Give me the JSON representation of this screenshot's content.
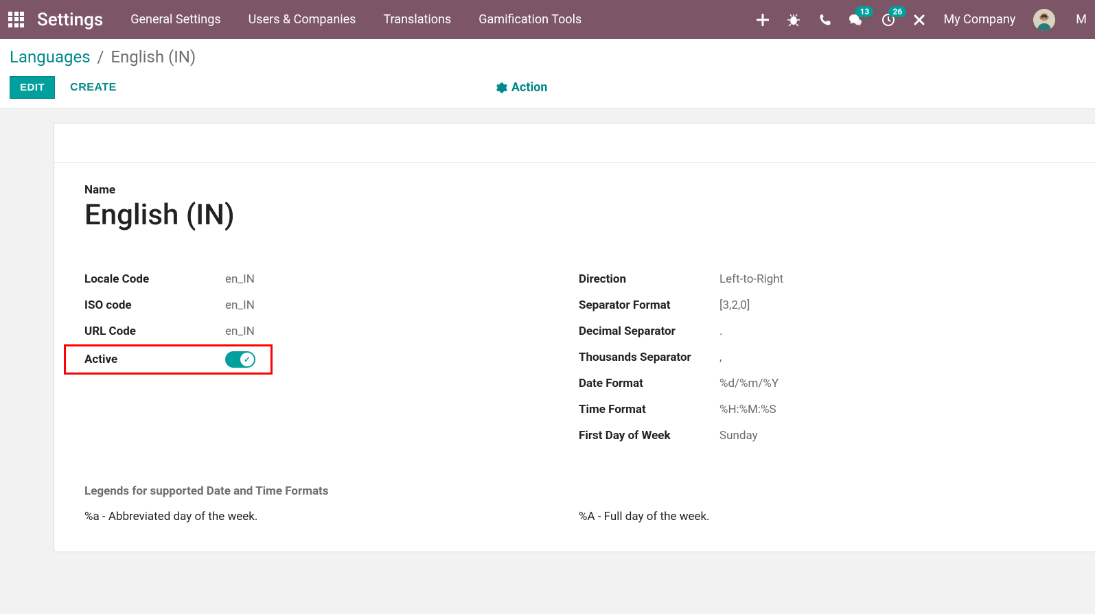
{
  "navbar": {
    "brand": "Settings",
    "links": [
      "General Settings",
      "Users & Companies",
      "Translations",
      "Gamification Tools"
    ],
    "chat_badge": "13",
    "activity_badge": "26",
    "company": "My Company",
    "user_initial": "M"
  },
  "breadcrumb": {
    "parent": "Languages",
    "current": "English (IN)"
  },
  "buttons": {
    "edit": "EDIT",
    "create": "CREATE",
    "action": "Action"
  },
  "form": {
    "name_label": "Name",
    "name_value": "English (IN)",
    "left": [
      {
        "label": "Locale Code",
        "value": "en_IN"
      },
      {
        "label": "ISO code",
        "value": "en_IN"
      },
      {
        "label": "URL Code",
        "value": "en_IN"
      }
    ],
    "active_label": "Active",
    "right": [
      {
        "label": "Direction",
        "value": "Left-to-Right"
      },
      {
        "label": "Separator Format",
        "value": "[3,2,0]"
      },
      {
        "label": "Decimal Separator",
        "value": "."
      },
      {
        "label": "Thousands Separator",
        "value": ","
      },
      {
        "label": "Date Format",
        "value": "%d/%m/%Y"
      },
      {
        "label": "Time Format",
        "value": "%H:%M:%S"
      },
      {
        "label": "First Day of Week",
        "value": "Sunday"
      }
    ],
    "legends_header": "Legends for supported Date and Time Formats",
    "legends_left": [
      "%a - Abbreviated day of the week."
    ],
    "legends_right": [
      "%A - Full day of the week."
    ]
  }
}
